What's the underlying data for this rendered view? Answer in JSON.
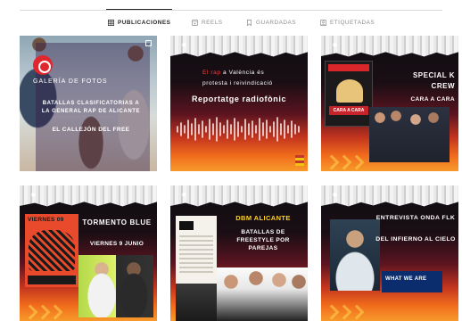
{
  "tabs": [
    {
      "label": "PUBLICACIONES",
      "icon": "grid-icon",
      "active": true
    },
    {
      "label": "REELS",
      "icon": "reels-icon",
      "active": false
    },
    {
      "label": "GUARDADAS",
      "icon": "bookmark-icon",
      "active": false
    },
    {
      "label": "ETIQUETADAS",
      "icon": "tagged-icon",
      "active": false
    }
  ],
  "posts": [
    {
      "gallery": "GALERÍA DE FOTOS",
      "subtitle": "BATALLAS CLASIFICATORIAS A LA GENERAL RAP DE ALICANTE",
      "title": "EL CALLEJÓN DEL FREE"
    },
    {
      "line1_highlight": "El rap",
      "line1_rest": "a València és",
      "line2": "protesta i reivindicació",
      "title": "Reportatge radiofònic"
    },
    {
      "title_line1": "SPECIAL K",
      "title_line2": "CREW",
      "subtitle": "CARA A CARA",
      "poster_label": "CARA A CARA"
    },
    {
      "poster_header": "VIERNES 09",
      "title": "TORMENTO BLUE",
      "date": "VIERNES 9 JUNIO"
    },
    {
      "title": "DBM ALICANTE",
      "subtitle": "BATALLAS DE FREESTYLE POR PAREJAS"
    },
    {
      "title": "ENTREVISTA ONDA FLK",
      "subtitle": "DEL INFIERNO AL CIELO",
      "box_text": "WHAT WE ARE"
    }
  ],
  "colors": {
    "tab_active": "#262626",
    "tab_inactive": "#8e8e8e",
    "accent_yellow": "#ffd21f",
    "accent_red": "#ff3b3b"
  }
}
